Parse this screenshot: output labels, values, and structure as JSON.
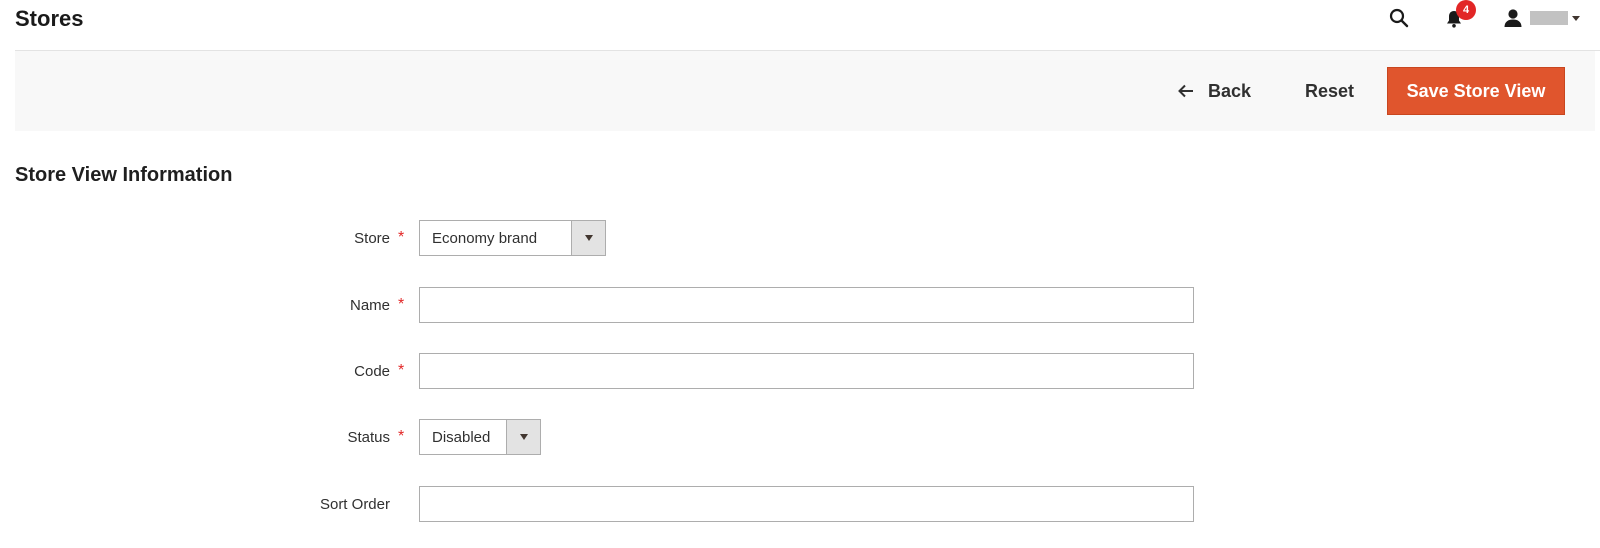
{
  "header": {
    "title": "Stores",
    "notifications_count": "4"
  },
  "actions": {
    "back_label": "Back",
    "reset_label": "Reset",
    "save_label": "Save Store View"
  },
  "section": {
    "title": "Store View Information"
  },
  "form": {
    "store": {
      "label": "Store",
      "required": "*",
      "value": "Economy brand"
    },
    "name": {
      "label": "Name",
      "required": "*",
      "value": ""
    },
    "code": {
      "label": "Code",
      "required": "*",
      "value": ""
    },
    "status": {
      "label": "Status",
      "required": "*",
      "value": "Disabled"
    },
    "sort_order": {
      "label": "Sort Order",
      "value": ""
    }
  },
  "colors": {
    "primary_button": "#e0552d",
    "required_star": "#e22626",
    "notification_badge": "#e22626"
  },
  "icons": {
    "search": "search-icon",
    "notifications": "bell-icon",
    "account": "user-icon",
    "back": "arrow-left-icon",
    "dropdown": "caret-down-icon"
  }
}
